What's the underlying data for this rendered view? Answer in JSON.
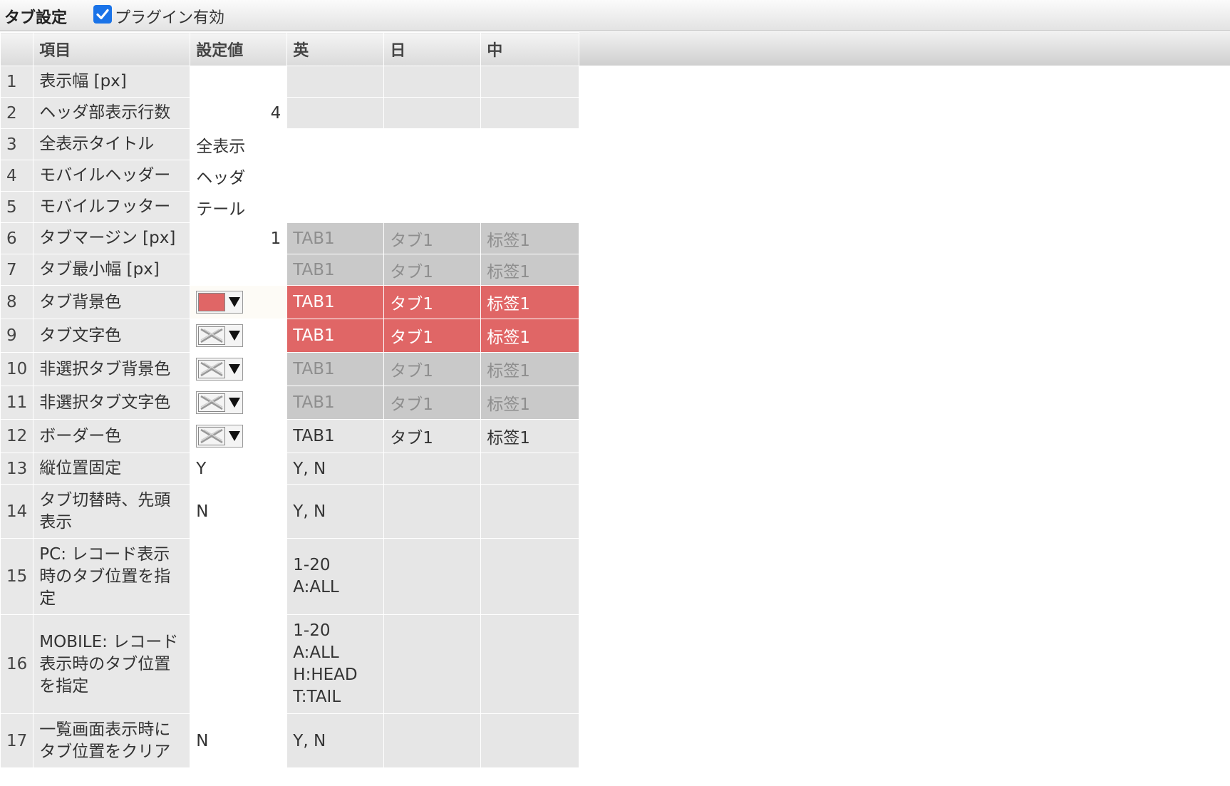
{
  "topbar": {
    "title": "タブ設定",
    "plugin_enabled_label": "プラグイン有効",
    "plugin_enabled": true
  },
  "columns": {
    "item": "項目",
    "value": "設定値",
    "en": "英",
    "ja": "日",
    "zh": "中"
  },
  "rows": [
    {
      "num": "1",
      "item": "表示幅 [px]",
      "value": "",
      "en": "",
      "ja": "",
      "zh": ""
    },
    {
      "num": "2",
      "item": "ヘッダ部表示行数",
      "value": "4",
      "en": "",
      "ja": "",
      "zh": ""
    },
    {
      "num": "3",
      "item": "全表示タイトル",
      "value": "全表示",
      "en": "",
      "ja": "",
      "zh": ""
    },
    {
      "num": "4",
      "item": "モバイルヘッダー",
      "value": "ヘッダ",
      "en": "",
      "ja": "",
      "zh": ""
    },
    {
      "num": "5",
      "item": "モバイルフッター",
      "value": "テール",
      "en": "",
      "ja": "",
      "zh": ""
    },
    {
      "num": "6",
      "item": "タブマージン [px]",
      "value": "1",
      "en": "TAB1",
      "ja": "タブ1",
      "zh": "标签1"
    },
    {
      "num": "7",
      "item": "タブ最小幅 [px]",
      "value": "",
      "en": "TAB1",
      "ja": "タブ1",
      "zh": "标签1"
    },
    {
      "num": "8",
      "item": "タブ背景色",
      "value": "#e06666",
      "en": "TAB1",
      "ja": "タブ1",
      "zh": "标签1"
    },
    {
      "num": "9",
      "item": "タブ文字色",
      "value": "",
      "en": "TAB1",
      "ja": "タブ1",
      "zh": "标签1"
    },
    {
      "num": "10",
      "item": "非選択タブ背景色",
      "value": "",
      "en": "TAB1",
      "ja": "タブ1",
      "zh": "标签1"
    },
    {
      "num": "11",
      "item": "非選択タブ文字色",
      "value": "",
      "en": "TAB1",
      "ja": "タブ1",
      "zh": "标签1"
    },
    {
      "num": "12",
      "item": "ボーダー色",
      "value": "",
      "en": "TAB1",
      "ja": "タブ1",
      "zh": "标签1"
    },
    {
      "num": "13",
      "item": "縦位置固定",
      "value": "Y",
      "en": "Y, N",
      "ja": "",
      "zh": ""
    },
    {
      "num": "14",
      "item": "タブ切替時、先頭表示",
      "value": "N",
      "en": "Y, N",
      "ja": "",
      "zh": ""
    },
    {
      "num": "15",
      "item": "PC: レコード表示時のタブ位置を指定",
      "value": "",
      "en": "1-20\nA:ALL",
      "ja": "",
      "zh": ""
    },
    {
      "num": "16",
      "item": "MOBILE: レコード表示時のタブ位置を指定",
      "value": "",
      "en": "1-20\nA:ALL\nH:HEAD\nT:TAIL",
      "ja": "",
      "zh": ""
    },
    {
      "num": "17",
      "item": "一覧画面表示時にタブ位置をクリア",
      "value": "N",
      "en": "Y, N",
      "ja": "",
      "zh": ""
    }
  ],
  "colors": {
    "tab_red": "#e06666",
    "pale_gray": "#c9c9c9",
    "checkbox_blue": "#1a73e8"
  },
  "icons": {
    "checkbox": "checkmark-icon",
    "color_empty": "no-color-x-icon",
    "dropdown": "triangle-down-icon"
  }
}
